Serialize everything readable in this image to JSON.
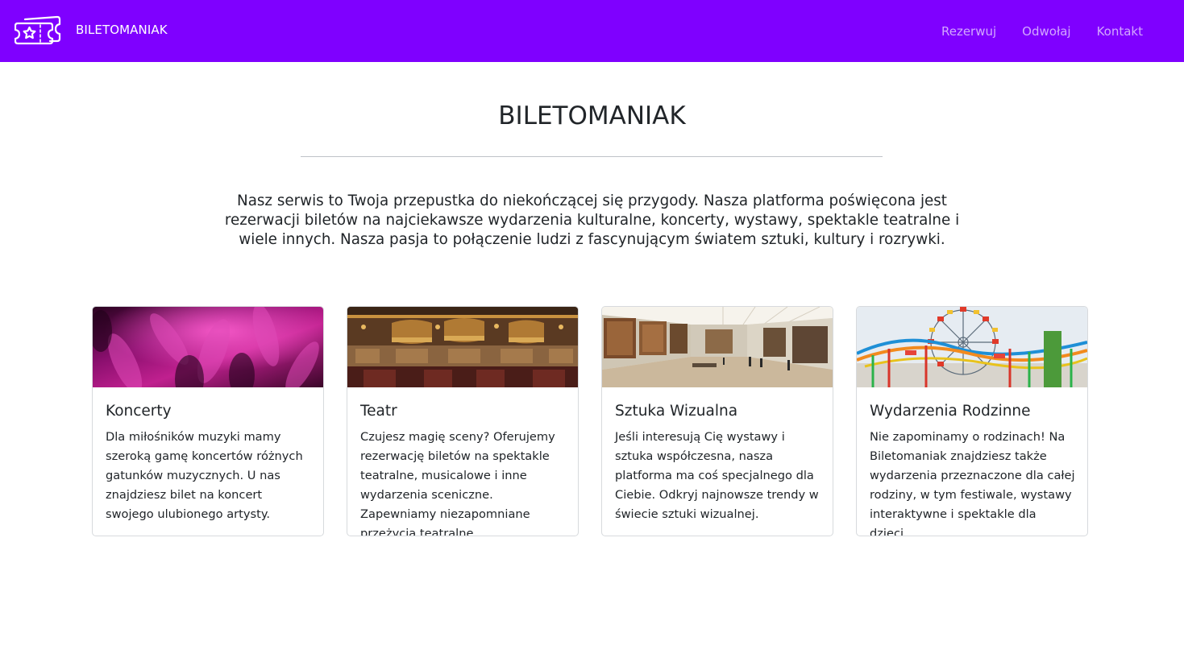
{
  "navbar": {
    "brand": "BILETOMANIAK",
    "links": [
      "Rezerwuj",
      "Odwołaj",
      "Kontakt"
    ],
    "background": "#7f00ff"
  },
  "hero": {
    "title": "BILETOMANIAK",
    "intro": "Nasz serwis to Twoja przepustka do niekończącej się przygody. Nasza platforma poświęcona jest rezerwacji biletów na najciekawsze wydarzenia kulturalne, koncerty, wystawy, spektakle teatralne i wiele innych. Nasza pasja to połączenie ludzi z fascynującym światem sztuki, kultury i rozrywki."
  },
  "cards": [
    {
      "title": "Koncerty",
      "text": "Dla miłośników muzyki mamy szeroką gamę koncertów różnych gatunków muzycznych. U nas znajdziesz bilet na koncert swojego ulubionego artysty.",
      "image": "concert-crowd-photo"
    },
    {
      "title": "Teatr",
      "text": "Czujesz magię sceny? Oferujemy rezerwację biletów na spektakle teatralne, musicalowe i inne wydarzenia sceniczne. Zapewniamy niezapomniane przeżycia teatralne.",
      "image": "theater-balconies-photo"
    },
    {
      "title": "Sztuka Wizualna",
      "text": "Jeśli interesują Cię wystawy i sztuka współczesna, nasza platforma ma coś specjalnego dla Ciebie. Odkryj najnowsze trendy w świecie sztuki wizualnej.",
      "image": "art-gallery-photo"
    },
    {
      "title": "Wydarzenia Rodzinne",
      "text": "Nie zapominamy o rodzinach! Na Biletomaniak znajdziesz także wydarzenia przeznaczone dla całej rodziny, w tym festiwale, wystawy interaktywne i spektakle dla dzieci.",
      "image": "amusement-park-photo"
    }
  ]
}
